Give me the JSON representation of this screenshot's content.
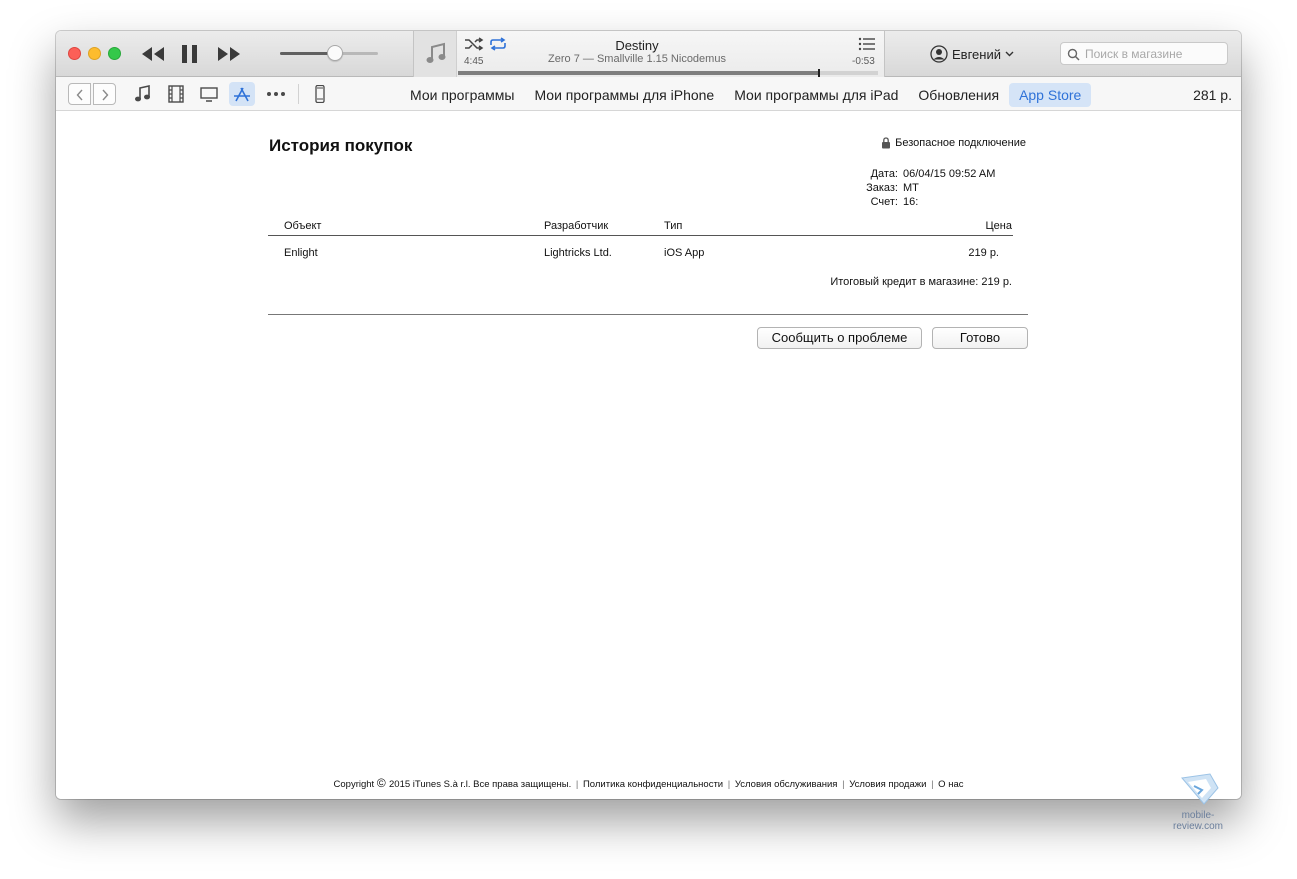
{
  "player": {
    "now_playing_title": "Destiny",
    "now_playing_subtitle": "Zero 7 — Smallville 1.15 Nicodemus",
    "elapsed": "4:45",
    "remaining": "-0:53",
    "progress_fraction": 0.86,
    "volume_fraction": 0.56
  },
  "account": {
    "name": "Евгений"
  },
  "search": {
    "placeholder": "Поиск в магазине"
  },
  "nav": {
    "tabs": [
      {
        "label": "Мои программы",
        "active": false
      },
      {
        "label": "Мои программы для iPhone",
        "active": false
      },
      {
        "label": "Мои программы для iPad",
        "active": false
      },
      {
        "label": "Обновления",
        "active": false
      },
      {
        "label": "App Store",
        "active": true
      }
    ],
    "balance": "281 р."
  },
  "page": {
    "title": "История покупок",
    "secure_label": "Безопасное подключение",
    "date_label": "Дата:",
    "date_value": "06/04/15 09:52 AM",
    "order_label": "Заказ:",
    "order_value": "MT",
    "invoice_label": "Счет:",
    "invoice_value": "16:"
  },
  "table": {
    "headers": {
      "object": "Объект",
      "developer": "Разработчик",
      "type": "Тип",
      "price": "Цена"
    },
    "rows": [
      {
        "object": "Enlight",
        "developer": "Lightricks Ltd.",
        "type": "iOS App",
        "price": "219 р."
      }
    ],
    "total": "Итоговый кредит в магазине: 219 р."
  },
  "buttons": {
    "report": "Сообщить о проблеме",
    "done": "Готово"
  },
  "footer": {
    "copyright": "Copyright",
    "copyright_rest": "2015 iTunes S.à r.l. Все права защищены.",
    "privacy": "Политика конфиденциальности",
    "terms": "Условия обслуживания",
    "sale": "Условия продажи",
    "about": "О нас"
  },
  "watermark": {
    "text": "mobile-review.com"
  },
  "colors": {
    "accent": "#2f72d8",
    "accent_bg": "#d5e4f7"
  }
}
